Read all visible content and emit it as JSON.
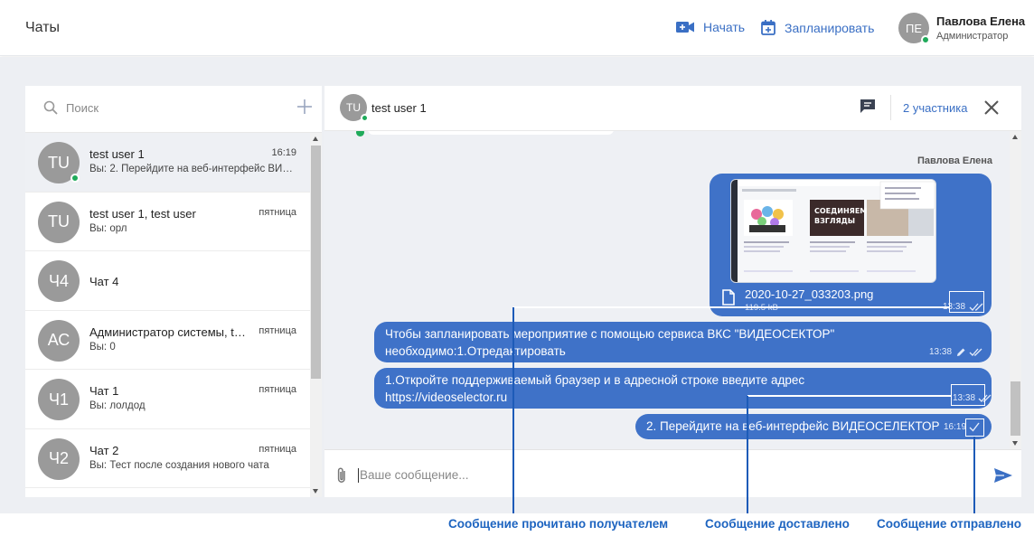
{
  "topbar": {
    "title": "Чаты",
    "start_label": "Начать",
    "schedule_label": "Запланировать",
    "user_initials": "ПЕ",
    "user_name": "Павлова Елена",
    "user_role": "Администратор"
  },
  "sidebar": {
    "search_placeholder": "Поиск",
    "chats": [
      {
        "initials": "TU",
        "name": "test user 1",
        "time": "16:19",
        "preview": "Вы: 2. Перейдите на веб-интерфейс ВИДЕОСЕЛЕКТОР",
        "online": true,
        "active": true
      },
      {
        "initials": "TU",
        "name": "test user 1, test user",
        "time": "пятница",
        "preview": "Вы: орл"
      },
      {
        "initials": "Ч4",
        "name": "Чат 4",
        "time": "",
        "preview": ""
      },
      {
        "initials": "АС",
        "name": "Администратор системы, test user 1",
        "time": "пятница",
        "preview": "Вы: 0"
      },
      {
        "initials": "Ч1",
        "name": "Чат 1",
        "time": "пятница",
        "preview": "Вы: лолдод"
      },
      {
        "initials": "Ч2",
        "name": "Чат 2",
        "time": "пятница",
        "preview": "Вы: Тест после создания нового чата"
      }
    ]
  },
  "chat": {
    "avatar_initials": "TU",
    "title": "test user 1",
    "participants_label": "2 участника",
    "sender_name": "Павлова Елена",
    "file": {
      "name": "2020-10-27_033203.png",
      "size": "119.5 kB",
      "time": "13:38"
    },
    "messages": [
      {
        "line1": "Чтобы запланировать мероприятие с помощью сервиса ВКС \"ВИДЕОСЕКТОР\"",
        "line2": "необходимо:1.Отредактировать",
        "time": "13:38",
        "status": "read"
      },
      {
        "line1": "1.Откройте поддерживаемый браузер и в адресной строке введите адрес",
        "line2": "https://videoselector.ru",
        "time": "13:38",
        "status": "delivered"
      },
      {
        "line1": "2. Перейдите на веб-интерфейс ВИДЕОСЕЛЕКТОР",
        "time": "16:19",
        "status": "sent"
      }
    ],
    "input_placeholder": "Ваше сообщение..."
  },
  "preview_image_texts": {
    "banner": "СОЕДИНЯЕМ ВЗГЛЯДЫ"
  },
  "annotations": {
    "read": "Сообщение прочитано получателем",
    "delivered": "Сообщение доставлено",
    "sent": "Сообщение отправлено"
  },
  "colors": {
    "accent": "#3a6fc4",
    "bubble": "#3f72c8",
    "online": "#1faa5a",
    "annotation": "#1d64c0"
  }
}
